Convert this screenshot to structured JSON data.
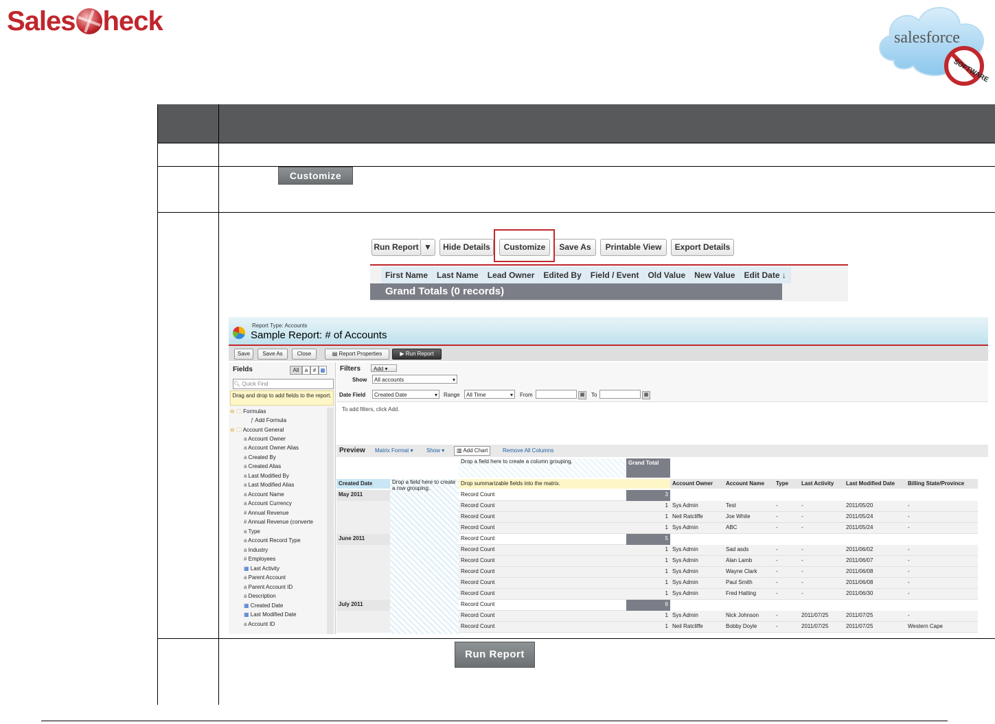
{
  "header": {
    "brand_left": {
      "part1": "Sales",
      "part2": "heck"
    },
    "brand_right": {
      "wordmark": "salesforce",
      "stamp": "SOFTWARE"
    }
  },
  "doc": {
    "step2_button": "Customize",
    "step4_button": "Run Report"
  },
  "sf_toolbar": {
    "run_report": "Run Report",
    "dropdown_icon": "caret-down-icon",
    "hide_details": "Hide Details",
    "customize": "Customize",
    "save_as": "Save As",
    "printable_view": "Printable View",
    "export_details": "Export Details"
  },
  "report_header": {
    "columns": [
      "First Name",
      "Last Name",
      "Lead Owner",
      "Edited By",
      "Field / Event",
      "Old Value",
      "New Value",
      "Edit Date ↓"
    ],
    "grand_totals": "Grand Totals (0 records)"
  },
  "builder": {
    "report_type": "Report Type: Accounts",
    "title": "Sample Report: # of Accounts",
    "toolbar": {
      "save": "Save",
      "save_as": "Save As",
      "close": "Close",
      "properties": "Report Properties",
      "run": "Run Report"
    },
    "fields": {
      "title": "Fields",
      "filter_all": "All",
      "filter_hash": "#",
      "quick_find_placeholder": "Quick Find",
      "hint": "Drag and drop to add fields to the report.",
      "tree": [
        {
          "label": "Formulas",
          "type": "folder",
          "indent": 0
        },
        {
          "label": "Add Formula",
          "type": "formula",
          "indent": 2
        },
        {
          "label": "Account General",
          "type": "folder",
          "indent": 0
        },
        {
          "label": "Account Owner",
          "type": "text",
          "indent": 1
        },
        {
          "label": "Account Owner Alias",
          "type": "text",
          "indent": 1
        },
        {
          "label": "Created By",
          "type": "text",
          "indent": 1
        },
        {
          "label": "Created Alias",
          "type": "text",
          "indent": 1
        },
        {
          "label": "Last Modified By",
          "type": "text",
          "indent": 1
        },
        {
          "label": "Last Modified Alias",
          "type": "text",
          "indent": 1
        },
        {
          "label": "Account Name",
          "type": "text",
          "indent": 1
        },
        {
          "label": "Account Currency",
          "type": "text",
          "indent": 1
        },
        {
          "label": "Annual Revenue",
          "type": "number",
          "indent": 1
        },
        {
          "label": "Annual Revenue (converte",
          "type": "number",
          "indent": 1
        },
        {
          "label": "Type",
          "type": "text",
          "indent": 1
        },
        {
          "label": "Account Record Type",
          "type": "text",
          "indent": 1
        },
        {
          "label": "Industry",
          "type": "text",
          "indent": 1
        },
        {
          "label": "Employees",
          "type": "number",
          "indent": 1
        },
        {
          "label": "Last Activity",
          "type": "date",
          "indent": 1
        },
        {
          "label": "Parent Account",
          "type": "text",
          "indent": 1
        },
        {
          "label": "Parent Account ID",
          "type": "text",
          "indent": 1
        },
        {
          "label": "Description",
          "type": "text",
          "indent": 1
        },
        {
          "label": "Created Date",
          "type": "date",
          "indent": 1
        },
        {
          "label": "Last Modified Date",
          "type": "date",
          "indent": 1
        },
        {
          "label": "Account ID",
          "type": "text",
          "indent": 1
        }
      ]
    },
    "filters": {
      "title": "Filters",
      "add": "Add",
      "show_label": "Show",
      "show_value": "All accounts",
      "date_field_label": "Date Field",
      "date_field_value": "Created Date",
      "range_label": "Range",
      "range_value": "All Time",
      "from_label": "From",
      "to_label": "To",
      "hint": "To add filters, click Add."
    },
    "preview": {
      "title": "Preview",
      "format": "Matrix Format",
      "show": "Show",
      "add_chart": "Add Chart",
      "remove_all": "Remove All Columns",
      "col_drop": "Drop a field here to create a column grouping.",
      "row_drop": "Drop a field here to create a row grouping.",
      "summ_drop": "Drop summarizable fields into the matrix.",
      "grand_total": "Grand Total",
      "row_header": "Created Date",
      "detail_cols": [
        "Account Owner",
        "Account Name",
        "Type",
        "Last Activity",
        "Last Modified Date",
        "Billing State/Province"
      ],
      "groups": [
        {
          "label": "May 2011",
          "total": "3",
          "rows": [
            {
              "count": "1",
              "owner": "Sys Admin",
              "name": "Test",
              "type": "-",
              "activity": "-",
              "modified": "2011/05/20",
              "state": "-"
            },
            {
              "count": "1",
              "owner": "Neil Ratcliffe",
              "name": "Joe White",
              "type": "-",
              "activity": "-",
              "modified": "2011/05/24",
              "state": "-"
            },
            {
              "count": "1",
              "owner": "Sys Admin",
              "name": "ABC",
              "type": "-",
              "activity": "-",
              "modified": "2011/05/24",
              "state": "-"
            }
          ]
        },
        {
          "label": "June 2011",
          "total": "5",
          "rows": [
            {
              "count": "1",
              "owner": "Sys Admin",
              "name": "Sad asds",
              "type": "-",
              "activity": "-",
              "modified": "2011/06/02",
              "state": "-"
            },
            {
              "count": "1",
              "owner": "Sys Admin",
              "name": "Alan Lamb",
              "type": "-",
              "activity": "-",
              "modified": "2011/06/07",
              "state": "-"
            },
            {
              "count": "1",
              "owner": "Sys Admin",
              "name": "Wayne Clark",
              "type": "-",
              "activity": "-",
              "modified": "2011/06/08",
              "state": "-"
            },
            {
              "count": "1",
              "owner": "Sys Admin",
              "name": "Paul Smith",
              "type": "-",
              "activity": "-",
              "modified": "2011/06/08",
              "state": "-"
            },
            {
              "count": "1",
              "owner": "Sys Admin",
              "name": "Fred Hatting",
              "type": "-",
              "activity": "-",
              "modified": "2011/06/30",
              "state": "-"
            }
          ]
        },
        {
          "label": "July 2011",
          "total": "6",
          "rows": [
            {
              "count": "1",
              "owner": "Sys Admin",
              "name": "Nick Johnson",
              "type": "-",
              "activity": "2011/07/25",
              "modified": "2011/07/25",
              "state": "-"
            },
            {
              "count": "1",
              "owner": "Neil Ratcliffe",
              "name": "Bobby Doyle",
              "type": "-",
              "activity": "2011/07/25",
              "modified": "2011/07/25",
              "state": "Western Cape"
            }
          ]
        }
      ],
      "row_label": "Record Count"
    }
  }
}
